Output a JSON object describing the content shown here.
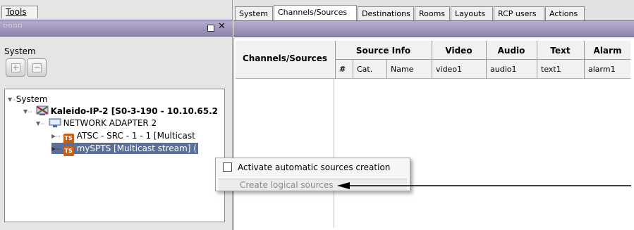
{
  "left_panel": {
    "tools_tab": "Tools",
    "grip": "▫▫▫▫",
    "system_label": "System",
    "add_button": "+",
    "remove_button": "−",
    "tree": {
      "root": "System",
      "device": "Kaleido-IP-2 [S0-3-190 - 10.10.65.2",
      "adapter": "NETWORK ADAPTER 2",
      "stream1": "ATSC - SRC - 1 - 1  [Multicast",
      "stream2": "mySPTS [Multicast stream] (",
      "ts_badge": "TS"
    }
  },
  "tabs": [
    "System",
    "Channels/Sources",
    "Destinations",
    "Rooms",
    "Layouts",
    "RCP users",
    "Actions"
  ],
  "active_tab": "Channels/Sources",
  "grid": {
    "row_header": "Channels/Sources",
    "groups": [
      "Source Info",
      "Video",
      "Audio",
      "Text",
      "Alarm"
    ],
    "subheaders": [
      "#",
      "Cat.",
      "Name",
      "video1",
      "audio1",
      "text1",
      "alarm1"
    ]
  },
  "context_menu": {
    "item1": "Activate automatic sources creation",
    "item2": "Create logical sources"
  },
  "icons": {
    "root_toggle": "expanded-triangle-icon",
    "device": "kaleido-device-icon",
    "adapter": "network-adapter-icon",
    "stream": "transport-stream-icon"
  },
  "colors": {
    "titlebar": "#9d94bb",
    "ts_badge": "#c95e1b",
    "arrow": "#000000"
  }
}
